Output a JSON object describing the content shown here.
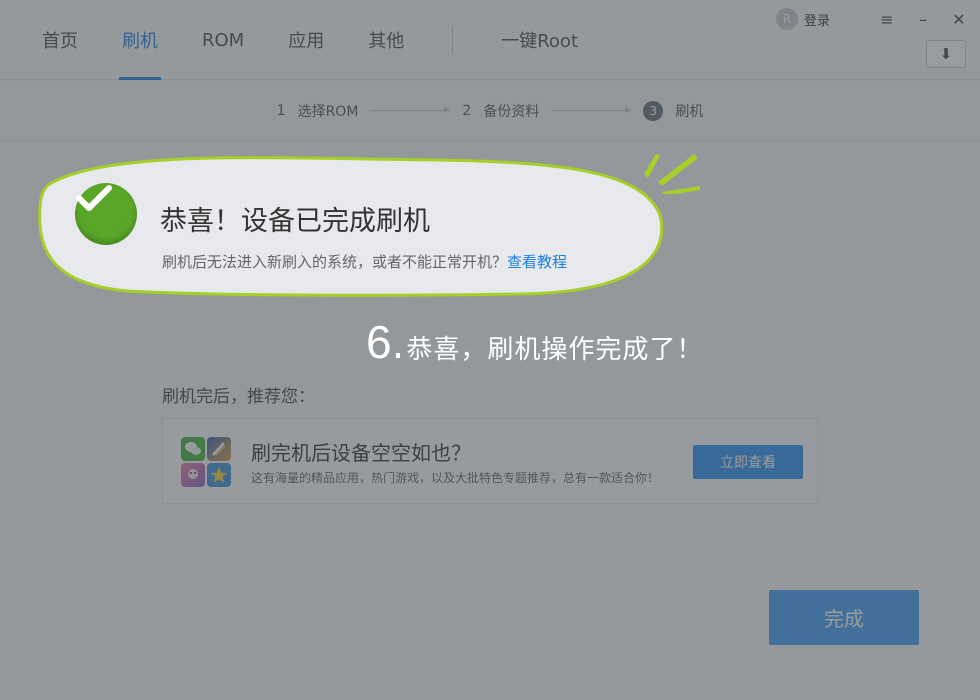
{
  "nav": {
    "items": [
      {
        "label": "首页",
        "active": false
      },
      {
        "label": "刷机",
        "active": true
      },
      {
        "label": "ROM",
        "active": false
      },
      {
        "label": "应用",
        "active": false
      },
      {
        "label": "其他",
        "active": false
      }
    ],
    "root_label": "一键Root"
  },
  "header": {
    "login_label": "登录",
    "avatar_glyph": "R",
    "menu_glyph": "≡",
    "minimize_glyph": "–",
    "close_glyph": "✕",
    "download_glyph": "⬇"
  },
  "steps": [
    {
      "num": "1",
      "label": "选择ROM",
      "current": false
    },
    {
      "num": "2",
      "label": "备份资料",
      "current": false
    },
    {
      "num": "3",
      "label": "刷机",
      "current": true
    }
  ],
  "bubble": {
    "title": "恭喜！设备已完成刷机",
    "text": "刷机后无法进入新刷入的系统，或者不能正常开机？",
    "link": "查看教程"
  },
  "caption": {
    "number": "6",
    "dot": ".",
    "text": "恭喜，刷机操作完成了！"
  },
  "recommend": {
    "title": "刷机完后，推荐您：",
    "headline": "刷完机后设备空空如也？",
    "subtext": "这有海量的精品应用，热门游戏，以及大批特色专题推荐，总有一款适合你！",
    "button": "立即查看"
  },
  "done_button": "完成",
  "colors": {
    "accent": "#1f7fe0",
    "success": "#5aa629",
    "bubble_border": "#a6cf2a"
  }
}
